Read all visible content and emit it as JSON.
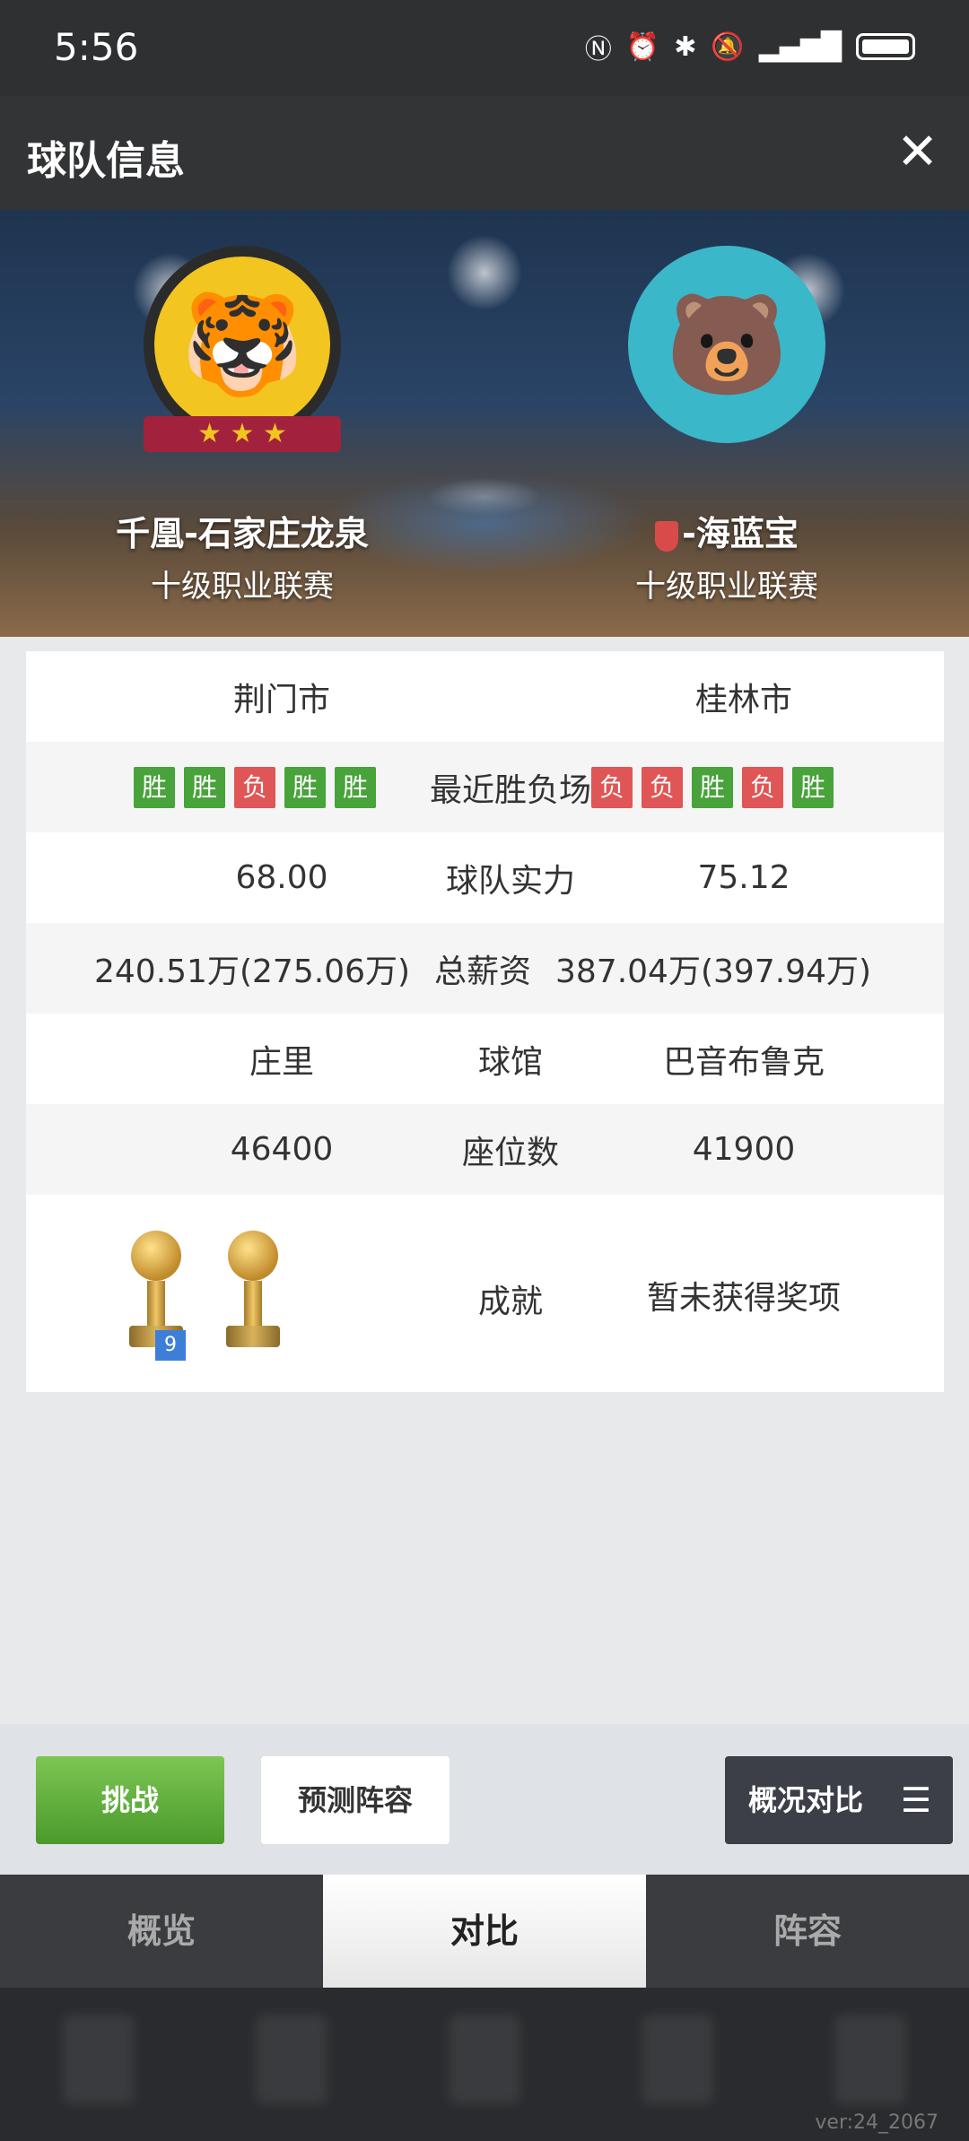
{
  "status_bar": {
    "time": "5:56",
    "icons": [
      "nfc-icon",
      "alarm-icon",
      "bluetooth-icon",
      "mute-icon",
      "4g-signal-icon",
      "battery-icon"
    ]
  },
  "header": {
    "title": "球队信息",
    "close_icon": "close-icon"
  },
  "banner": {
    "left_team": {
      "name": "千凰-石家庄龙泉",
      "league": "十级职业联赛",
      "logo": "tiger-logo",
      "ribbon": "★ ★ ★"
    },
    "right_team": {
      "name": "-海蓝宝",
      "league": "十级职业联赛",
      "logo": "bear-logo"
    }
  },
  "comparison": {
    "cities": {
      "left": "荆门市",
      "right": "桂林市"
    },
    "recent": {
      "label": "最近胜负场",
      "left": [
        "胜",
        "胜",
        "负",
        "胜",
        "胜"
      ],
      "right": [
        "负",
        "负",
        "胜",
        "负",
        "胜"
      ]
    },
    "strength": {
      "label": "球队实力",
      "left": "68.00",
      "right": "75.12"
    },
    "salary": {
      "label": "总薪资",
      "left": "240.51万(275.06万)",
      "right": "387.04万(397.94万)"
    },
    "arena": {
      "label": "球馆",
      "left": "庄里",
      "right": "巴音布鲁克"
    },
    "seats": {
      "label": "座位数",
      "left": "46400",
      "right": "41900"
    },
    "achievements": {
      "label": "成就",
      "left_trophy_count": "9",
      "right": "暂未获得奖项"
    }
  },
  "actions": {
    "challenge": "挑战",
    "predict": "预测阵容",
    "compare": "概况对比"
  },
  "tabs": [
    "概览",
    "对比",
    "阵容"
  ],
  "active_tab": "对比",
  "version": "ver:24_2067",
  "colors": {
    "win": "#47a33a",
    "loss": "#e05555",
    "accent_green": "#5aac35",
    "dark": "#323436"
  }
}
